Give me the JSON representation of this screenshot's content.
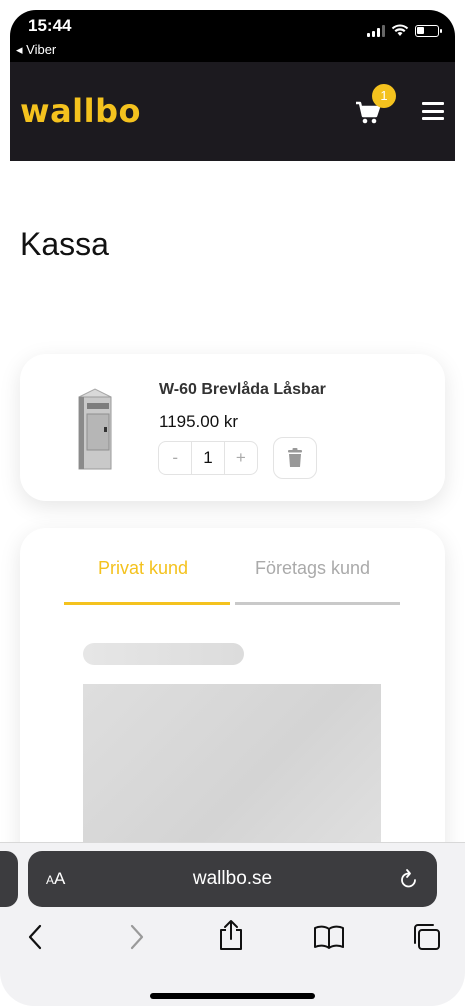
{
  "status_bar": {
    "time": "15:44",
    "back_app": "◂ Viber"
  },
  "header": {
    "logo": "wallbo",
    "cart_count": "1"
  },
  "page": {
    "title": "Kassa"
  },
  "cart_item": {
    "name": "W-60 Brevlåda Låsbar",
    "price": "1195.00 kr",
    "quantity": "1",
    "minus_label": "-",
    "plus_label": "+"
  },
  "checkout_tabs": [
    {
      "label": "Privat kund",
      "active": true
    },
    {
      "label": "Företags kund",
      "active": false
    }
  ],
  "browser": {
    "aa_label_small": "A",
    "aa_label": "A",
    "url": "wallbo.se"
  },
  "colors": {
    "accent": "#f4c21e",
    "header_bg": "#1c1a1f"
  }
}
